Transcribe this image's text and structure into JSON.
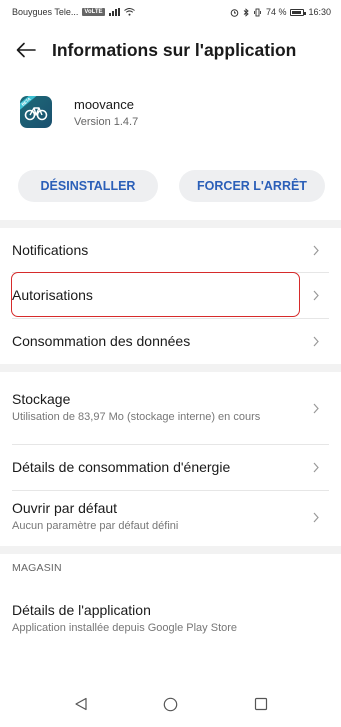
{
  "status_bar": {
    "carrier": "Bouygues Tele...",
    "network_badge": "VoLTE",
    "battery_percent": "74 %",
    "time": "16:30",
    "icons": [
      "signal-icon",
      "wifi-icon",
      "alarm-icon",
      "bluetooth-icon",
      "vibrate-icon",
      "battery-icon"
    ]
  },
  "header": {
    "back_icon": "arrow-left-icon",
    "title": "Informations sur l'application"
  },
  "app": {
    "name": "moovance",
    "version": "Version 1.4.7",
    "icon": "moovance-bike-icon",
    "icon_colors": {
      "background": "#1d6b78",
      "badge": "#3ec1d3"
    }
  },
  "actions": {
    "uninstall_label": "DÉSINSTALLER",
    "force_stop_label": "FORCER L'ARRÊT",
    "accent_color": "#2b5fb8"
  },
  "list": {
    "notifications": "Notifications",
    "permissions": "Autorisations",
    "data_usage": "Consommation des données",
    "storage_title": "Stockage",
    "storage_sub": "Utilisation de 83,97 Mo (stockage interne) en cours",
    "battery_details": "Détails de consommation d'énergie",
    "open_default_title": "Ouvrir par défaut",
    "open_default_sub": "Aucun paramètre par défaut défini"
  },
  "store_section": {
    "header": "MAGASIN",
    "details_title": "Détails de l'application",
    "details_sub": "Application installée depuis Google Play Store"
  },
  "highlight_color": "#d62b2b",
  "nav": {
    "icons": [
      "back-triangle-icon",
      "home-circle-icon",
      "recents-square-icon"
    ]
  }
}
